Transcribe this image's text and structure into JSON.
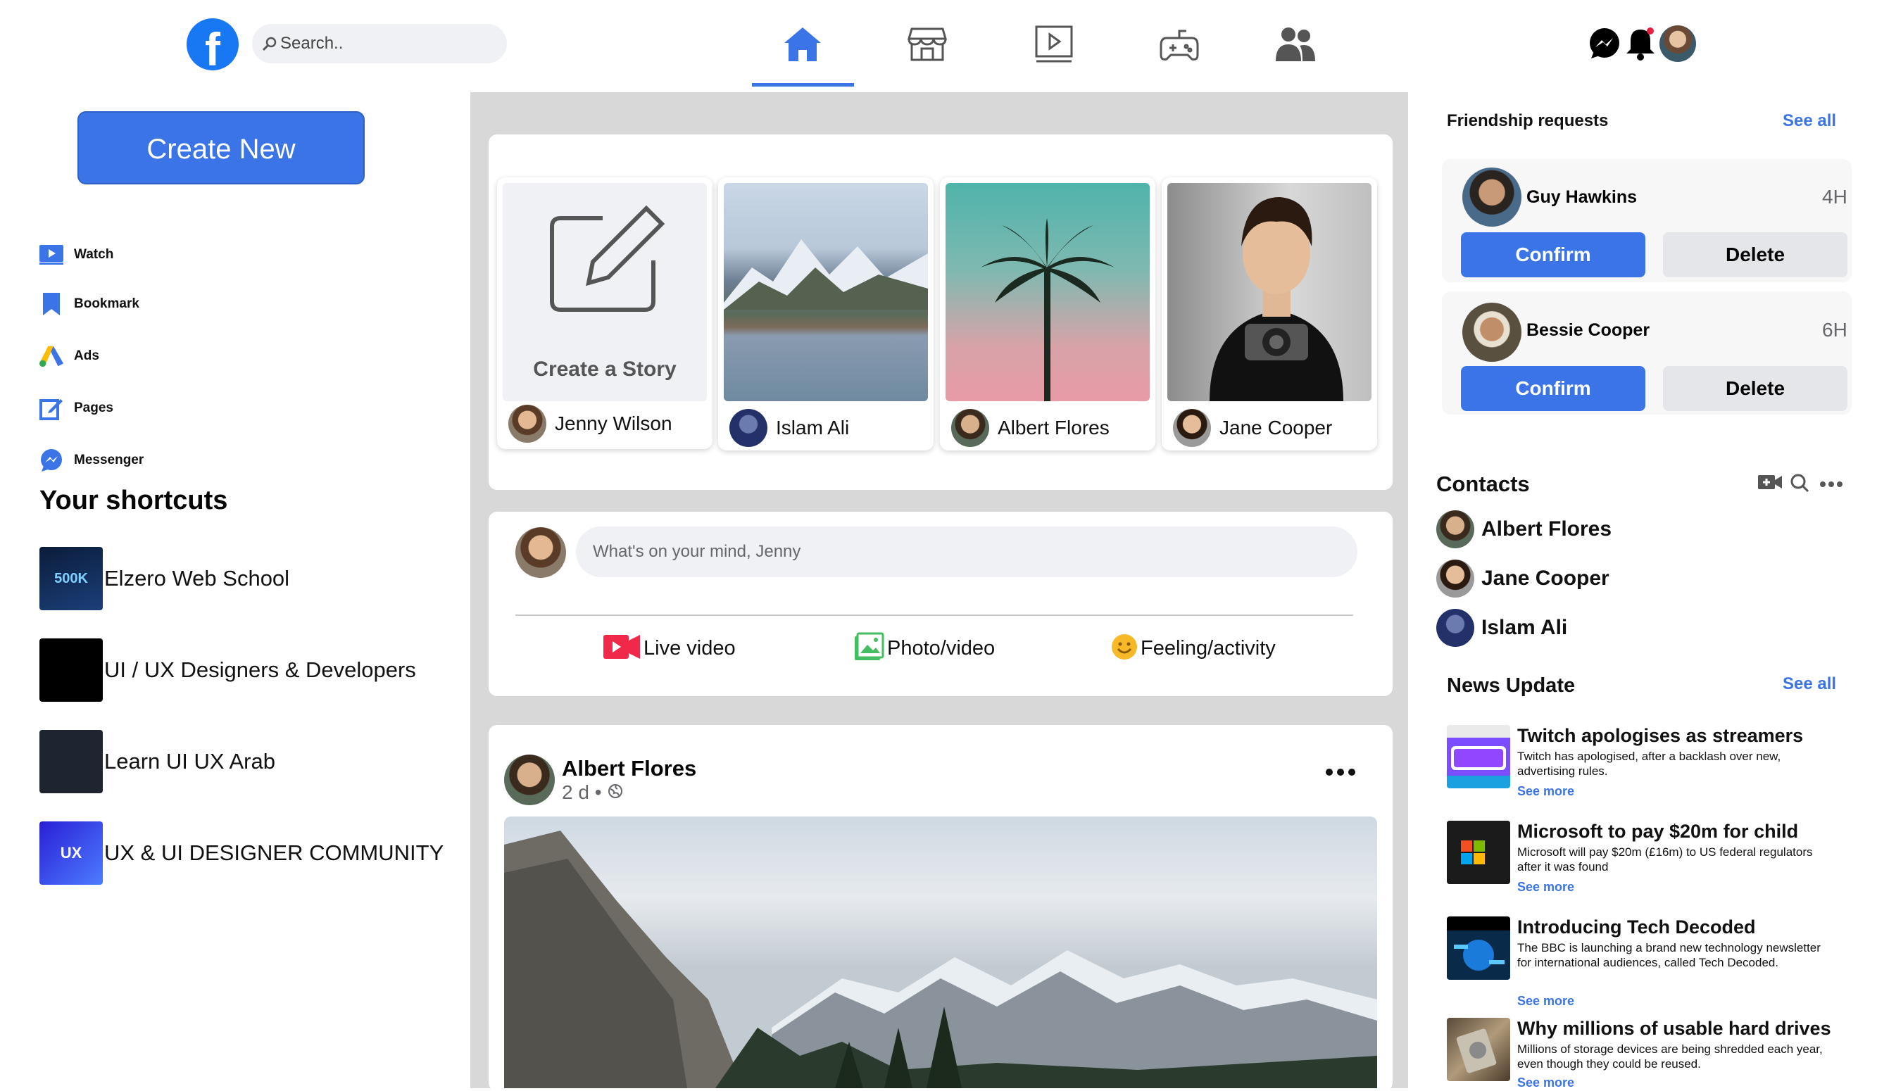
{
  "topbar": {
    "logo_letter": "f",
    "search_placeholder": "Search..",
    "nav": [
      "home-icon",
      "marketplace-icon",
      "watch-icon",
      "gaming-icon",
      "groups-icon"
    ],
    "active_nav": "home-icon",
    "right_icons": [
      "messenger-icon",
      "bell-icon",
      "profile-avatar"
    ]
  },
  "sidebar": {
    "create_label": "Create New",
    "items": [
      {
        "label": "Watch",
        "icon": "watch-icon"
      },
      {
        "label": "Bookmark",
        "icon": "bookmark-icon"
      },
      {
        "label": "Ads",
        "icon": "ads-icon"
      },
      {
        "label": "Pages",
        "icon": "pages-icon"
      },
      {
        "label": "Messenger",
        "icon": "messenger-icon"
      }
    ],
    "shortcuts_title": "Your shortcuts",
    "shortcuts": [
      {
        "label": "Elzero Web School",
        "thumb_text": "500K"
      },
      {
        "label": "UI / UX Designers & Developers",
        "thumb_text": ""
      },
      {
        "label": "Learn UI UX Arab",
        "thumb_text": ""
      },
      {
        "label": "UX & UI DESIGNER COMMUNITY",
        "thumb_text": "UX"
      }
    ]
  },
  "stories": {
    "create_label": "Create a Story",
    "items": [
      {
        "name": "Jenny Wilson"
      },
      {
        "name": "Islam Ali"
      },
      {
        "name": "Albert Flores"
      },
      {
        "name": "Jane Cooper"
      }
    ]
  },
  "composer": {
    "placeholder": "What's on your mind, Jenny",
    "actions": [
      {
        "label": "Live video",
        "icon": "live-video-icon"
      },
      {
        "label": "Photo/video",
        "icon": "photo-icon"
      },
      {
        "label": "Feeling/activity",
        "icon": "feeling-icon"
      }
    ]
  },
  "post": {
    "author": "Albert Flores",
    "time": "2 d •",
    "privacy_icon": "globe-icon"
  },
  "friend_requests": {
    "title": "Friendship requests",
    "see_all": "See all",
    "confirm_label": "Confirm",
    "delete_label": "Delete",
    "items": [
      {
        "name": "Guy Hawkins",
        "time": "4H"
      },
      {
        "name": "Bessie Cooper",
        "time": "6H"
      }
    ]
  },
  "contacts": {
    "title": "Contacts",
    "items": [
      "Albert Flores",
      "Jane Cooper",
      "Islam Ali"
    ]
  },
  "news": {
    "title": "News Update",
    "see_all": "See all",
    "see_more": "See more",
    "items": [
      {
        "title": "Twitch apologises as streamers",
        "desc": "Twitch has apologised, after a backlash over new, advertising rules."
      },
      {
        "title": "Microsoft to pay $20m for child",
        "desc": "Microsoft will pay $20m (£16m) to US federal regulators after it was found"
      },
      {
        "title": "Introducing Tech Decoded",
        "desc": "The BBC is launching a brand new technology newsletter for international audiences, called Tech Decoded."
      },
      {
        "title": "Why millions of usable hard drives",
        "desc": "Millions of storage devices are being shredded each year, even though they could be reused."
      }
    ]
  },
  "colors": {
    "accent": "#3b74e6",
    "feed_bg": "#d8d8d8"
  }
}
